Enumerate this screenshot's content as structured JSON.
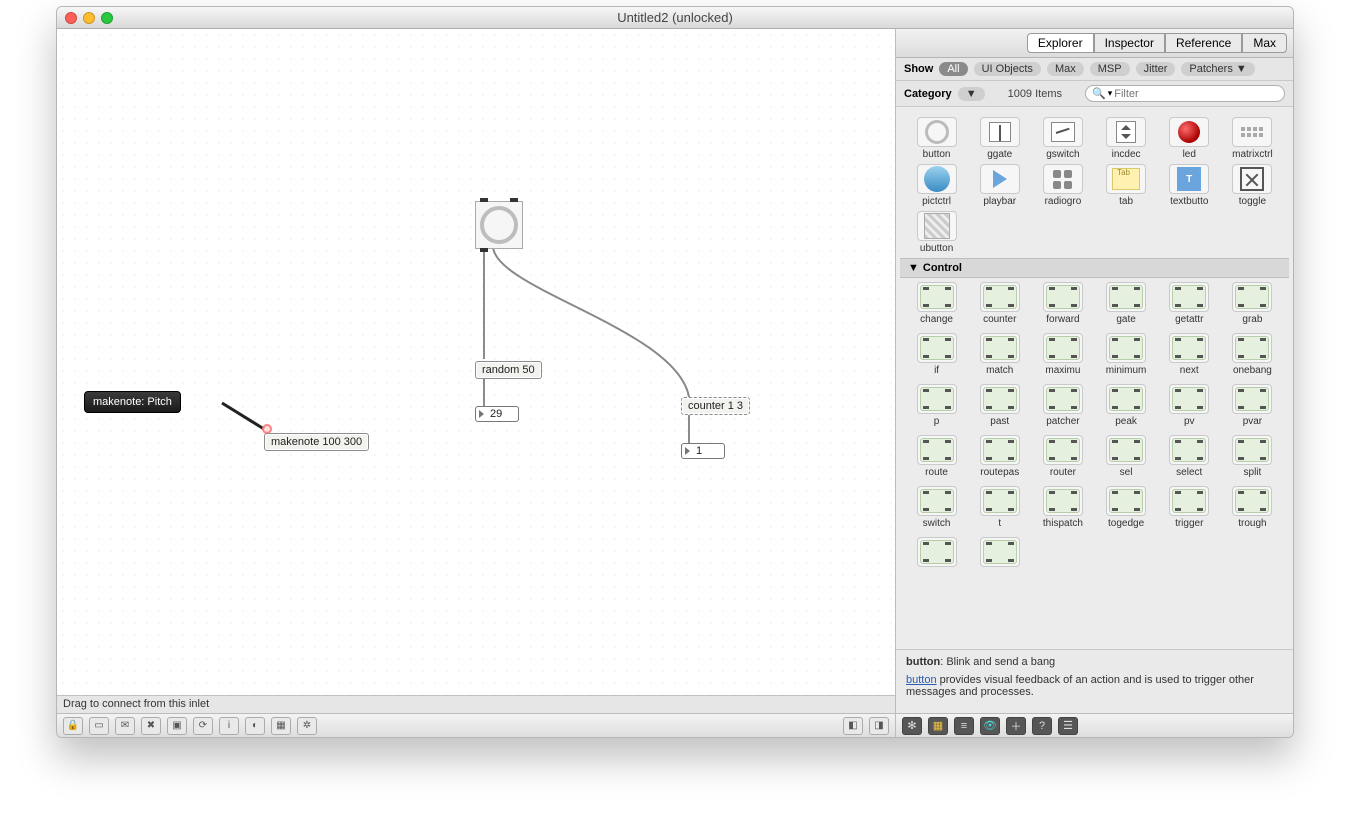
{
  "window": {
    "title": "Untitled2 (unlocked)"
  },
  "tooltip": "makenote: Pitch",
  "objects": {
    "makenote": "makenote 100 300",
    "random": "random 50",
    "counter": "counter 1 3",
    "num1": "29",
    "num2": "1"
  },
  "statusbar": "Drag to connect from this inlet",
  "side": {
    "tabs": [
      "Explorer",
      "Inspector",
      "Reference",
      "Max"
    ],
    "active_tab": "Explorer",
    "show_label": "Show",
    "filters": [
      "All",
      "UI Objects",
      "Max",
      "MSP",
      "Jitter",
      "Patchers ▼"
    ],
    "active_filter": "All",
    "category_label": "Category",
    "items_count": "1009 Items",
    "search_placeholder": "Filter",
    "row1": [
      "button",
      "ggate",
      "gswitch",
      "incdec",
      "led",
      "matrixctrl"
    ],
    "row2": [
      "pictctrl",
      "playbar",
      "radiogro",
      "tab",
      "textbutto",
      "toggle"
    ],
    "row3": [
      "ubutton"
    ],
    "control_header": "Control",
    "control_rows": [
      [
        "change",
        "counter",
        "forward",
        "gate",
        "getattr",
        "grab"
      ],
      [
        "if",
        "match",
        "maximu",
        "minimum",
        "next",
        "onebang"
      ],
      [
        "p",
        "past",
        "patcher",
        "peak",
        "pv",
        "pvar"
      ],
      [
        "route",
        "routepas",
        "router",
        "sel",
        "select",
        "split"
      ],
      [
        "switch",
        "t",
        "thispatch",
        "togedge",
        "trigger",
        "trough"
      ]
    ],
    "control_partial": [
      "",
      ""
    ],
    "help": {
      "bold": "button",
      "short": ": Blink and send a bang",
      "link": "button",
      "rest": " provides visual feedback of an action and is used to trigger other messages and processes."
    }
  }
}
